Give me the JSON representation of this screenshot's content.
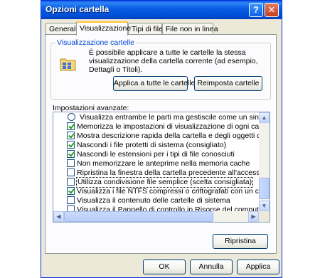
{
  "window": {
    "title": "Opzioni cartella",
    "help_button": "?",
    "close_button": "✕"
  },
  "tabs": [
    {
      "label": "Generale",
      "active": false
    },
    {
      "label": "Visualizzazione",
      "active": true
    },
    {
      "label": "Tipi di file",
      "active": false
    },
    {
      "label": "File non in linea",
      "active": false
    }
  ],
  "folder_views": {
    "title": "Visualizzazione cartelle",
    "icon": "folder-icon",
    "description": "È possibile applicare a tutte le cartelle la stessa visualizzazione della cartella corrente (ad esempio, Dettagli o Titoli).",
    "apply_all_label": "Applica a tutte le cartelle",
    "reset_label": "Reimposta cartelle"
  },
  "advanced": {
    "label": "Impostazioni avanzate:",
    "items": [
      {
        "type": "radio",
        "checked": false,
        "text": "Visualizza entrambe le parti ma gestiscile come un singolo file"
      },
      {
        "type": "checkbox",
        "checked": true,
        "text": "Memorizza le impostazioni di visualizzazione di ogni cartella"
      },
      {
        "type": "checkbox",
        "checked": true,
        "text": "Mostra descrizione rapida della cartella e degli oggetti del desktop"
      },
      {
        "type": "checkbox",
        "checked": true,
        "text": "Nascondi i file protetti di sistema (consigliato)"
      },
      {
        "type": "checkbox",
        "checked": true,
        "text": "Nascondi le estensioni per i tipi di file conosciuti"
      },
      {
        "type": "checkbox",
        "checked": false,
        "text": "Non memorizzare le anteprime nella memoria cache"
      },
      {
        "type": "checkbox",
        "checked": false,
        "text": "Ripristina la finestra della cartella precedente all'accesso"
      },
      {
        "type": "checkbox",
        "checked": false,
        "text": "Utilizza condivisione file semplice (scelta consigliata)",
        "selected": true
      },
      {
        "type": "checkbox",
        "checked": true,
        "text": "Visualizza i file NTFS compressi o crittografati con un colore diverso"
      },
      {
        "type": "checkbox",
        "checked": false,
        "text": "Visualizza il contenuto delle cartelle di sistema"
      },
      {
        "type": "checkbox",
        "checked": false,
        "text": "Visualizza il Pannello di controllo in Risorse del computer"
      }
    ]
  },
  "restore_label": "Ripristina",
  "footer": {
    "ok_label": "OK",
    "cancel_label": "Annulla",
    "apply_label": "Applica"
  }
}
